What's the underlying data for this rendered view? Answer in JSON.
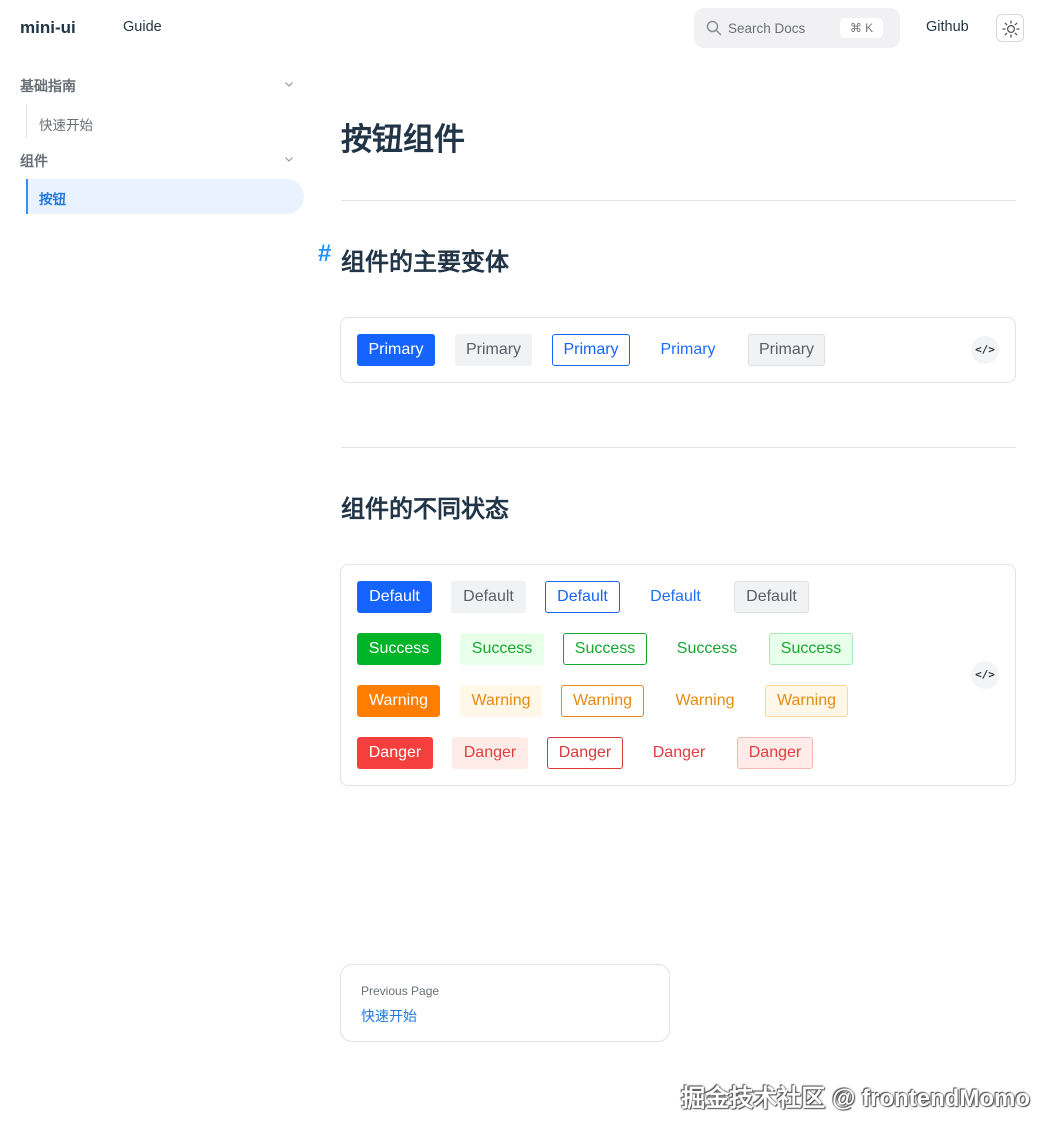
{
  "nav": {
    "logo": "mini-ui",
    "guide": "Guide",
    "search_placeholder": "Search Docs",
    "search_shortcut": "⌘ K",
    "github": "Github"
  },
  "sidebar": {
    "groups": [
      {
        "label": "基础指南",
        "items": [
          {
            "label": "快速开始",
            "active": false
          }
        ]
      },
      {
        "label": "组件",
        "items": [
          {
            "label": "按钮",
            "active": true
          }
        ]
      }
    ]
  },
  "main": {
    "title": "按钮组件",
    "section1": {
      "anchor": "#",
      "heading": "组件的主要变体"
    },
    "section2": {
      "heading": "组件的不同状态"
    },
    "code_icon": "</>",
    "variant_row": [
      "Primary",
      "Primary",
      "Primary",
      "Primary",
      "Primary"
    ],
    "state_rows": [
      {
        "type": "primary",
        "labels": [
          "Default",
          "Default",
          "Default",
          "Default",
          "Default"
        ]
      },
      {
        "type": "success",
        "labels": [
          "Success",
          "Success",
          "Success",
          "Success",
          "Success"
        ]
      },
      {
        "type": "warning",
        "labels": [
          "Warning",
          "Warning",
          "Warning",
          "Warning",
          "Warning"
        ]
      },
      {
        "type": "danger",
        "labels": [
          "Danger",
          "Danger",
          "Danger",
          "Danger",
          "Danger"
        ]
      }
    ],
    "button_variants": [
      "solid",
      "soft",
      "outline",
      "text",
      "light"
    ]
  },
  "footer": {
    "prev_label": "Previous Page",
    "prev_link": "快速开始"
  },
  "watermark": "掘金技术社区 @ frontendMomo",
  "colors": {
    "primary": "#1664ff",
    "success": "#00b42a",
    "warning": "#ff7d00",
    "danger": "#f53f3f",
    "accent": "#1f7ae0"
  }
}
